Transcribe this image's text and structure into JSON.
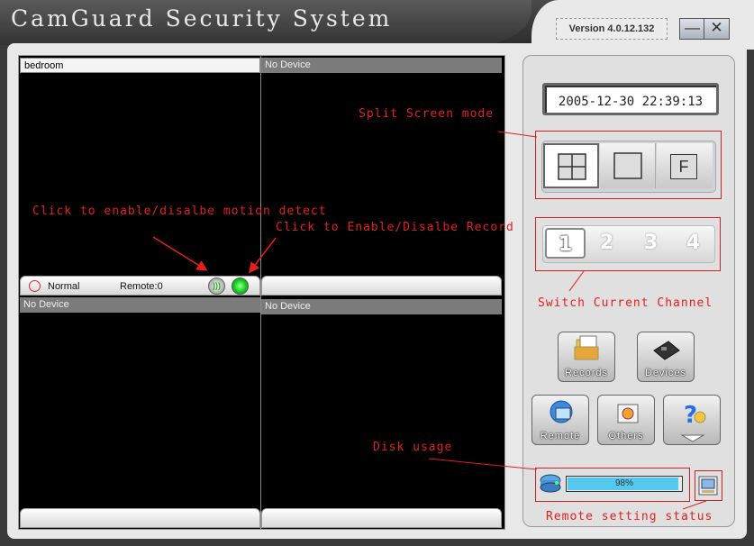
{
  "app": {
    "title": "CamGuard Security System",
    "version": "Version 4.0.12.132"
  },
  "window_controls": {
    "minimize": "—",
    "close": "✕"
  },
  "channels": [
    {
      "name": "bedroom",
      "active": true
    },
    {
      "name": "No Device",
      "active": false
    },
    {
      "name": "No Device",
      "active": false
    },
    {
      "name": "No Device",
      "active": false
    }
  ],
  "status_bar": {
    "status": "Normal",
    "remote": "Remote:0"
  },
  "clock": "2005-12-30 22:39:13",
  "split_modes": [
    {
      "name": "quad-view",
      "active": true
    },
    {
      "name": "single-view",
      "active": false
    },
    {
      "name": "fullscreen",
      "label": "F",
      "active": false
    }
  ],
  "channel_switch": [
    "1",
    "2",
    "3",
    "4"
  ],
  "current_channel": "1",
  "tools": {
    "records": "Records",
    "devices": "Devices",
    "remote": "Remote",
    "others": "Others"
  },
  "disk": {
    "label": "98%",
    "fraction": 0.98
  },
  "annotations": {
    "split_screen_mode": "Split Screen mode",
    "motion_detect": "Click to enable/disalbe motion detect",
    "record": "Click to Enable/Disalbe Record",
    "switch_channel": "Switch Current Channel",
    "disk_usage": "Disk usage",
    "remote_status": "Remote setting status"
  },
  "colors": {
    "annotation": "#e31f1f",
    "record_active": "#1ccc1c",
    "disk_fill": "#55c8f0"
  }
}
